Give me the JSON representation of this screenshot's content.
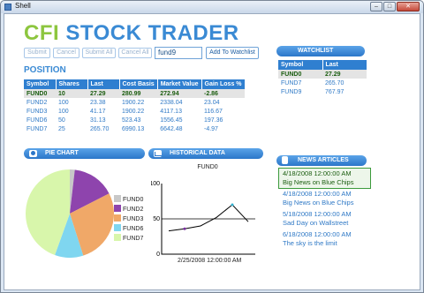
{
  "window": {
    "title": "Shell"
  },
  "brand": {
    "part1": "CFI",
    "part2": "STOCK TRADER"
  },
  "toolbar": {
    "submit": "Submit",
    "cancel": "Cancel",
    "submit_all": "Submit All",
    "cancel_all": "Cancel All",
    "symbol_value": "fund9",
    "add_to_watchlist": "Add To Watchlist"
  },
  "position": {
    "title": "POSITION",
    "columns": [
      "Symbol",
      "Shares",
      "Last",
      "Cost Basis",
      "Market Value",
      "Gain Loss %"
    ],
    "rows": [
      [
        "FUND0",
        "10",
        "27.29",
        "280.99",
        "272.94",
        "-2.86"
      ],
      [
        "FUND2",
        "100",
        "23.38",
        "1900.22",
        "2338.04",
        "23.04"
      ],
      [
        "FUND3",
        "100",
        "41.17",
        "1900.22",
        "4117.13",
        "116.67"
      ],
      [
        "FUND6",
        "50",
        "31.13",
        "523.43",
        "1556.45",
        "197.36"
      ],
      [
        "FUND7",
        "25",
        "265.70",
        "6990.13",
        "6642.48",
        "-4.97"
      ]
    ]
  },
  "watchlist": {
    "title": "WATCHLIST",
    "columns": [
      "Symbol",
      "Last"
    ],
    "rows": [
      [
        "FUND0",
        "27.29"
      ],
      [
        "FUND7",
        "265.70"
      ],
      [
        "FUND9",
        "767.97"
      ]
    ]
  },
  "pie_panel": {
    "title": "PIE CHART"
  },
  "history_panel": {
    "title": "HISTORICAL DATA"
  },
  "news_panel": {
    "title": "NEWS ARTICLES"
  },
  "news": [
    {
      "date": "4/18/2008 12:00:00 AM",
      "headline": "Big News on Blue Chips"
    },
    {
      "date": "4/18/2008 12:00:00 AM",
      "headline": "Big News on Blue Chips"
    },
    {
      "date": "5/18/2008 12:00:00 AM",
      "headline": "Sad Day on Wallstreet"
    },
    {
      "date": "6/18/2008 12:00:00 AM",
      "headline": "The sky is the limit"
    }
  ],
  "colors": {
    "brand_green": "#8dc63f",
    "brand_blue": "#3a8ad4",
    "header_blue": "#2f7fd0",
    "selected_text": "#1b5d10"
  },
  "chart_data": [
    {
      "type": "pie",
      "legend_position": "right",
      "categories": [
        "FUND0",
        "FUND2",
        "FUND3",
        "FUND6",
        "FUND7"
      ],
      "values": [
        272.94,
        2338.04,
        4117.13,
        1556.45,
        6642.48
      ],
      "colors": [
        "#c8c8c8",
        "#8e44ad",
        "#f0a868",
        "#7fd6f0",
        "#d8f6ab"
      ]
    },
    {
      "type": "line",
      "title": "FUND0",
      "ylim": [
        0,
        100
      ],
      "yticks": [
        0,
        50,
        100
      ],
      "xlabel": "2/25/2008 12:00:00 AM",
      "series": [
        {
          "x": [
            0,
            1,
            2,
            3,
            4,
            5
          ],
          "values": [
            33,
            36,
            40,
            52,
            70,
            46
          ]
        }
      ]
    }
  ]
}
